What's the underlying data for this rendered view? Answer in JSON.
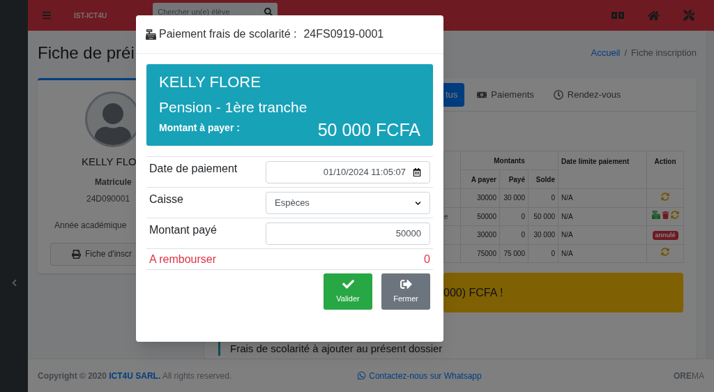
{
  "header": {
    "brand": "IST-ICT4U",
    "search": {
      "placeholder": "Chercher un(e) élève"
    }
  },
  "page": {
    "title": "Fiche de préi",
    "breadcrumb": [
      {
        "label": "Accueil",
        "link": true
      },
      {
        "label": "Fiche inscription",
        "link": false
      }
    ],
    "breadcrumb_separator": "/"
  },
  "profile_card": {
    "name": "KELLY FLO",
    "matricule_label": "Matricule",
    "matricule": "24D090001",
    "year_label": "Année académique",
    "print_button": "Fiche d'inscr"
  },
  "tabs": [
    {
      "label": "tus",
      "selected": true
    },
    {
      "label": "Paiements",
      "selected": false
    },
    {
      "label": "Rendez-vous",
      "selected": false
    }
  ],
  "fees_table": {
    "group_header": "Montants",
    "amount_columns": [
      "A payer",
      "Payé",
      "Solde"
    ],
    "date_column": "Date limite paiement",
    "action_column": "Action",
    "rows": [
      {
        "to_pay": "30000",
        "paid": "30 000",
        "balance": "0",
        "deadline": "N/A",
        "action": {
          "kind": "renew"
        }
      },
      {
        "column_1": "e",
        "to_pay": "50000",
        "paid": "0",
        "balance": "50 000",
        "deadline": "N/A",
        "action": {
          "kind": "pending"
        }
      },
      {
        "to_pay": "30000",
        "paid": "0",
        "balance": "30 000",
        "deadline": "N/A",
        "action": {
          "kind": "cancelled",
          "badge": "annulé"
        }
      },
      {
        "to_pay": "75000",
        "paid": "75 000",
        "balance": "0",
        "deadline": "N/A",
        "action": {
          "kind": "renew"
        }
      }
    ]
  },
  "alert": {
    "text": "000) FCFA !"
  },
  "section_title": "Frais de scolarité à ajouter au présent dossier",
  "footer": {
    "copyright": "**Copyright © 2020**",
    "company": "ICT4U SARL.",
    "rights": "All rights reserved.",
    "contact": "Contactez-nous sur Whatsapp",
    "brand": "**ORE**MA"
  },
  "modal": {
    "title": "Paiement frais de scolarité :",
    "reference": "24FS0919-0001",
    "summary": {
      "student": "KELLY FLORE",
      "fee": "Pension - 1ère tranche",
      "amount_label": "Montant à payer :",
      "amount": "50 000 FCFA"
    },
    "fields": [
      {
        "kind": "datetime",
        "label": "Date de paiement",
        "value": "01/10/2024 11:05:07"
      },
      {
        "kind": "select",
        "label": "Caisse",
        "value": "Espèces"
      },
      {
        "kind": "amount",
        "label": "Montant payé",
        "value": "50000"
      }
    ],
    "refund": {
      "label": "A rembourser",
      "value": "0"
    },
    "buttons": [
      {
        "kind": "confirm",
        "label": "Valider"
      },
      {
        "kind": "close",
        "label": "Fermer"
      }
    ]
  }
}
